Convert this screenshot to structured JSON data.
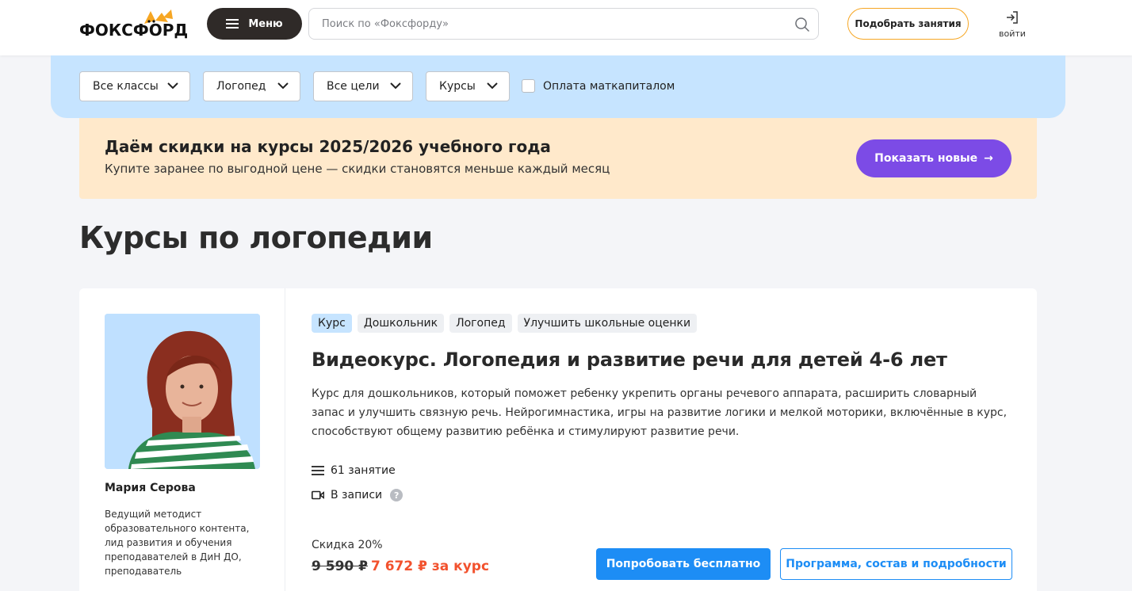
{
  "header": {
    "logo_text": "ФОКСФОРД",
    "menu_label": "Меню",
    "search_placeholder": "Поиск по «Фоксфорду»",
    "pick_label": "Подобрать занятия",
    "login_label": "войти"
  },
  "filters": {
    "selects": [
      {
        "label": "Все классы"
      },
      {
        "label": "Логопед"
      },
      {
        "label": "Все цели"
      },
      {
        "label": "Курсы"
      }
    ],
    "checkbox_label": "Оплата маткапиталом",
    "checkbox_checked": false
  },
  "promo": {
    "title": "Даём скидки на курсы 2025/2026 учебного года",
    "subtitle": "Купите заранее по выгодной цене — скидки становятся меньше каждый месяц",
    "button_label": "Показать новые",
    "button_arrow": "→"
  },
  "page_title": "Курсы по логопедии",
  "course": {
    "tags": [
      "Курс",
      "Дошкольник",
      "Логопед",
      "Улучшить школьные оценки"
    ],
    "title": "Видеокурс. Логопедия и развитие речи для детей 4-6 лет",
    "description": "Курс для дошкольников, который поможет ребенку укрепить органы речевого аппарата, расширить словарный запас и улучшить связную речь. Нейрогимнастика, игры на развитие логики и мелкой моторики, включённые в курс, способствуют общему развитию ребёнка и стимулируют развитие речи.",
    "lessons": "61 занятие",
    "format": "В записи",
    "help_mark": "?",
    "discount": "Скидка 20%",
    "old_price": "9 590 ₽",
    "new_price": "7 672 ₽ за курс",
    "try_button": "Попробовать бесплатно",
    "program_button": "Программа, состав и подробности",
    "teacher": {
      "name": "Мария Серова",
      "description": "Ведущий методист образовательного контента, лид развития и обучения преподавателей в ДиН ДО, преподаватель"
    }
  },
  "colors": {
    "accent_orange": "#f6a623",
    "filter_bg": "#c6e4ff",
    "promo_bg": "#ffe9cb",
    "promo_button": "#7c4be6",
    "primary_blue": "#1d8df5",
    "price_red": "#f2522e"
  }
}
